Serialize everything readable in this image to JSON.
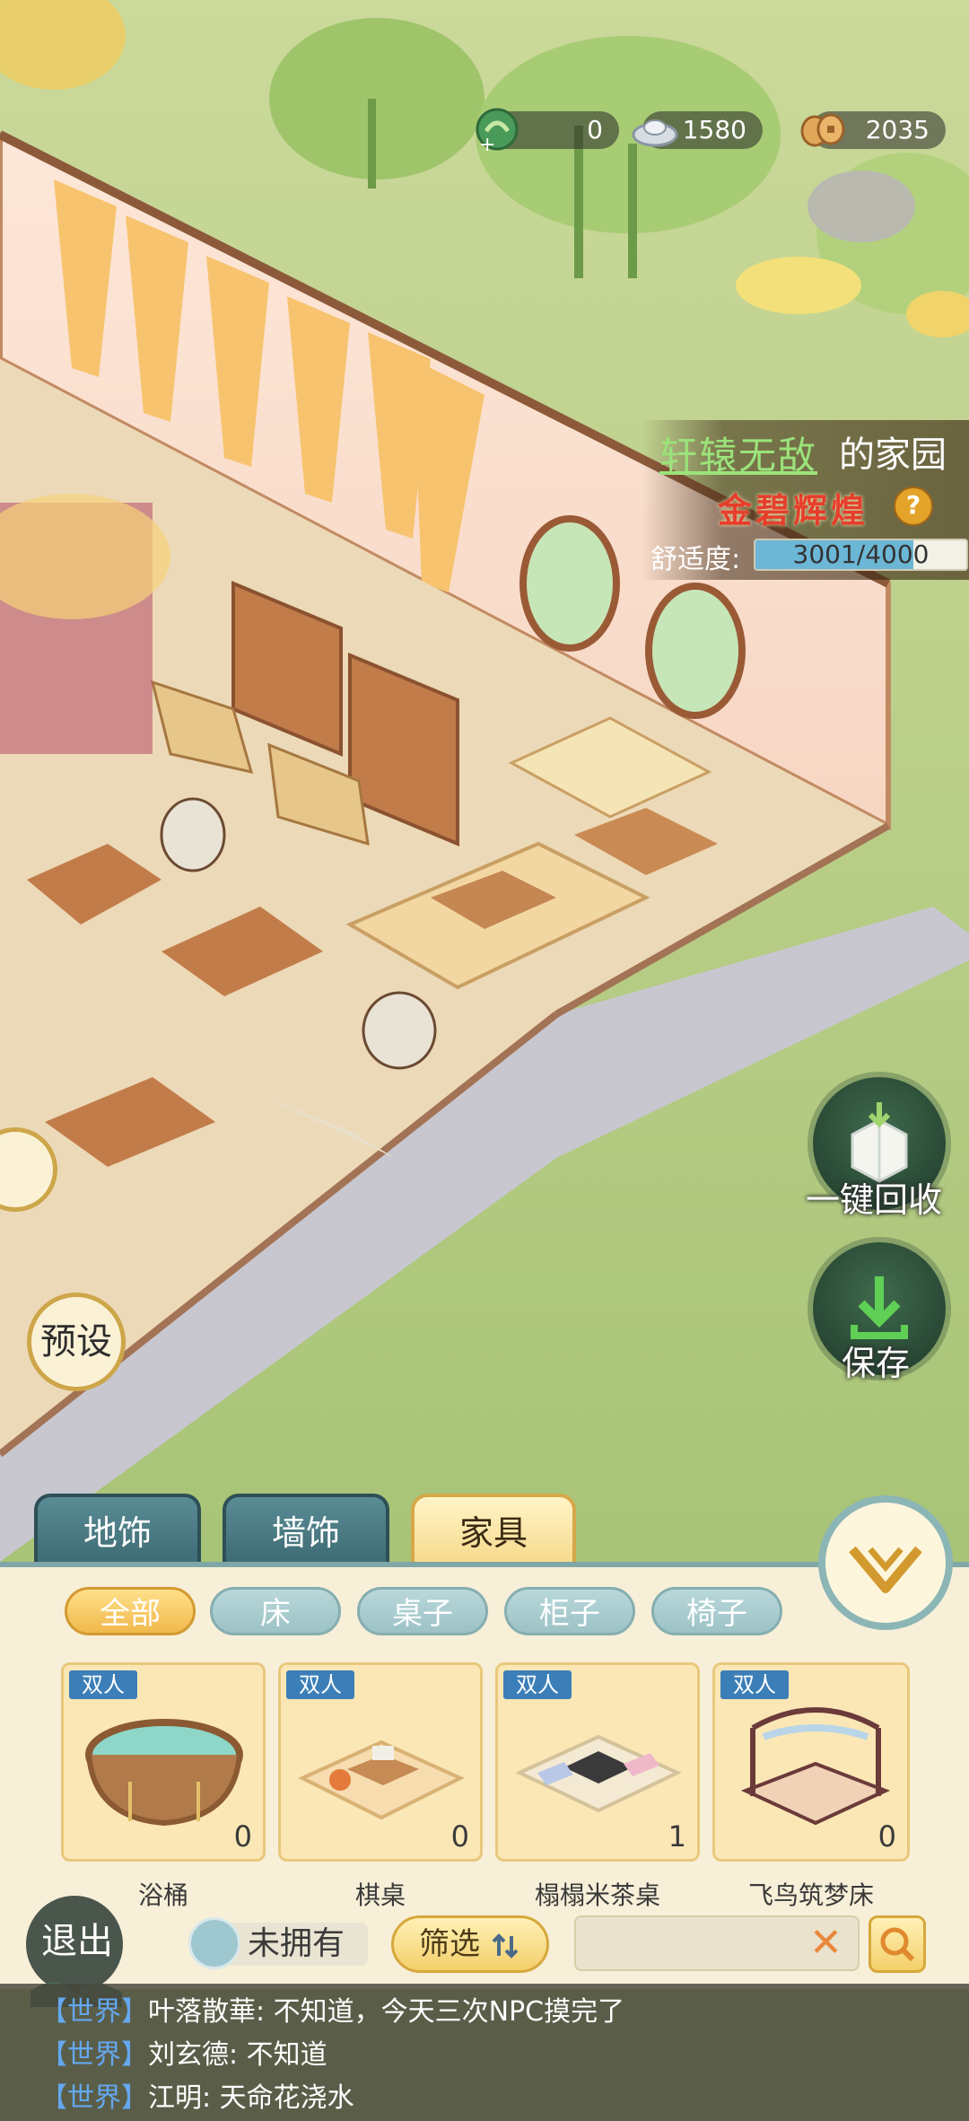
{
  "currencies": [
    {
      "name": "jade-dragon",
      "value": "0"
    },
    {
      "name": "silver-ingot",
      "value": "1580"
    },
    {
      "name": "copper-coins",
      "value": "2035"
    }
  ],
  "home": {
    "owner_name": "轩辕无敌",
    "owner_suffix": "的家园",
    "style": "金碧辉煌",
    "help": "?",
    "comfort_label": "舒适度:",
    "comfort_text": "3001/4000",
    "comfort_value": 3001,
    "comfort_max": 4000
  },
  "actions": {
    "recycle_all": "一键回收",
    "save": "保存",
    "preset": "预设"
  },
  "tabs": [
    {
      "label": "地饰",
      "active": false
    },
    {
      "label": "墙饰",
      "active": false
    },
    {
      "label": "家具",
      "active": true
    }
  ],
  "filters": [
    {
      "label": "全部",
      "selected": true
    },
    {
      "label": "床",
      "selected": false
    },
    {
      "label": "桌子",
      "selected": false
    },
    {
      "label": "柜子",
      "selected": false
    },
    {
      "label": "椅子",
      "selected": false
    }
  ],
  "items": [
    {
      "name": "浴桶",
      "badge": "双人",
      "count": "0",
      "icon": "bathtub-icon"
    },
    {
      "name": "棋桌",
      "badge": "双人",
      "count": "0",
      "icon": "chess-table-icon"
    },
    {
      "name": "榻榻米茶桌",
      "badge": "双人",
      "count": "1",
      "icon": "tatami-tea-table-icon"
    },
    {
      "name": "飞鸟筑梦床",
      "badge": "双人",
      "count": "0",
      "icon": "canopy-bed-icon"
    }
  ],
  "bottom": {
    "exit": "退出",
    "owned_label": "未拥有",
    "filter_label": "筛选",
    "search_placeholder": "",
    "clear": "✕"
  },
  "chat": [
    {
      "tag": "【世界】",
      "text": "叶落散華: 不知道，今天三次NPC摸完了"
    },
    {
      "tag": "【世界】",
      "text": "刘玄德: 不知道"
    },
    {
      "tag": "【世界】",
      "text": "江明: 天命花浇水"
    }
  ],
  "colors": {
    "owner_name": "#9be37a",
    "style": "#e63e2c",
    "chat_tag": "#64a8f0",
    "badge": "#3c7fb8"
  }
}
